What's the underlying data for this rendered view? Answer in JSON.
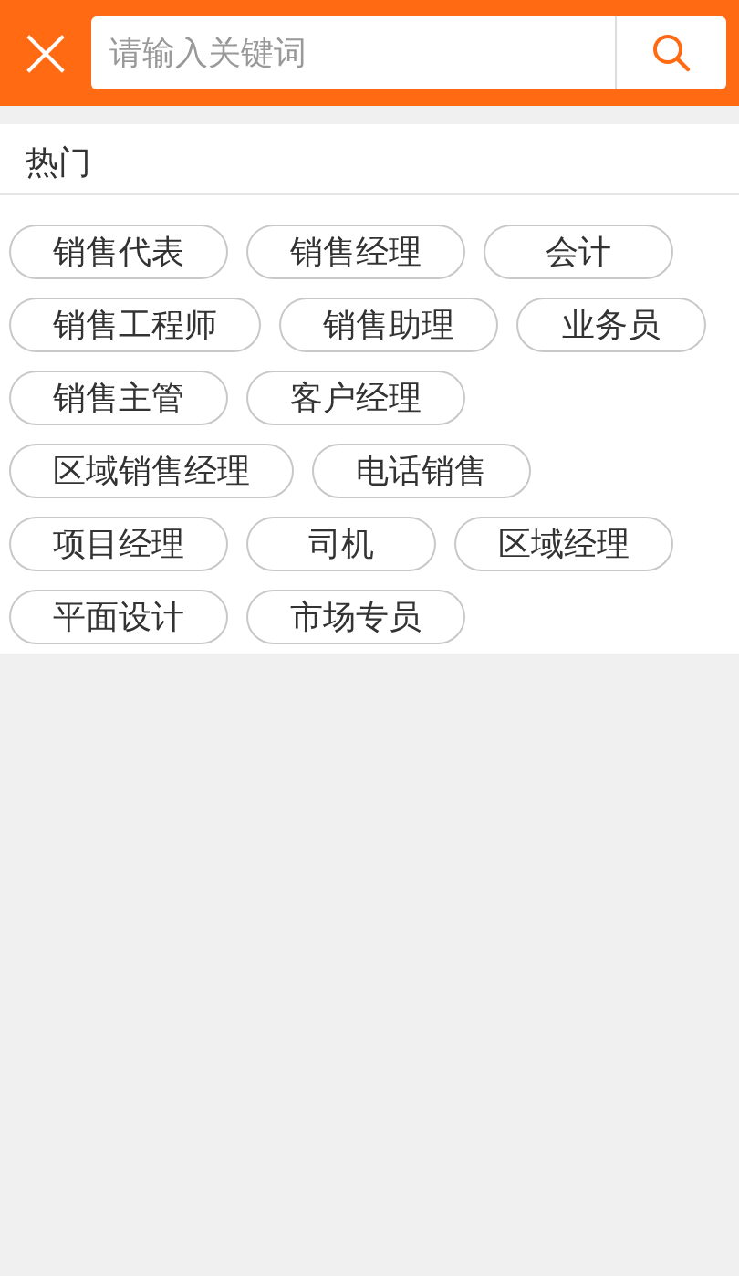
{
  "header": {
    "close": "×",
    "search": {
      "placeholder": "请输入关键词"
    }
  },
  "hot": {
    "title": "热门",
    "tags": [
      "销售代表",
      "销售经理",
      "会计",
      "销售工程师",
      "销售助理",
      "业务员",
      "销售主管",
      "客户经理",
      "区域销售经理",
      "电话销售",
      "项目经理",
      "司机",
      "区域经理",
      "平面设计",
      "市场专员"
    ]
  }
}
